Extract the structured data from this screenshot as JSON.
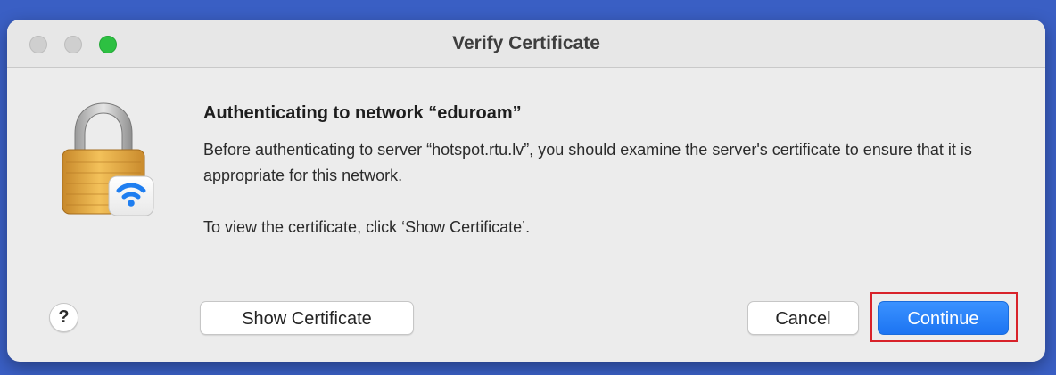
{
  "window": {
    "title": "Verify Certificate"
  },
  "dialog": {
    "heading": "Authenticating to network “eduroam”",
    "message": "Before authenticating to server “hotspot.rtu.lv”, you should examine the server's certificate to ensure that it is appropriate for this network.",
    "instruction": "To view the certificate, click ‘Show Certificate’.",
    "icon": "lock-wifi-icon"
  },
  "buttons": {
    "help_label": "?",
    "show_certificate_label": "Show Certificate",
    "cancel_label": "Cancel",
    "continue_label": "Continue"
  },
  "colors": {
    "accent": "#1c74f2",
    "highlight": "#d8222a",
    "zoom": "#2dc042"
  }
}
